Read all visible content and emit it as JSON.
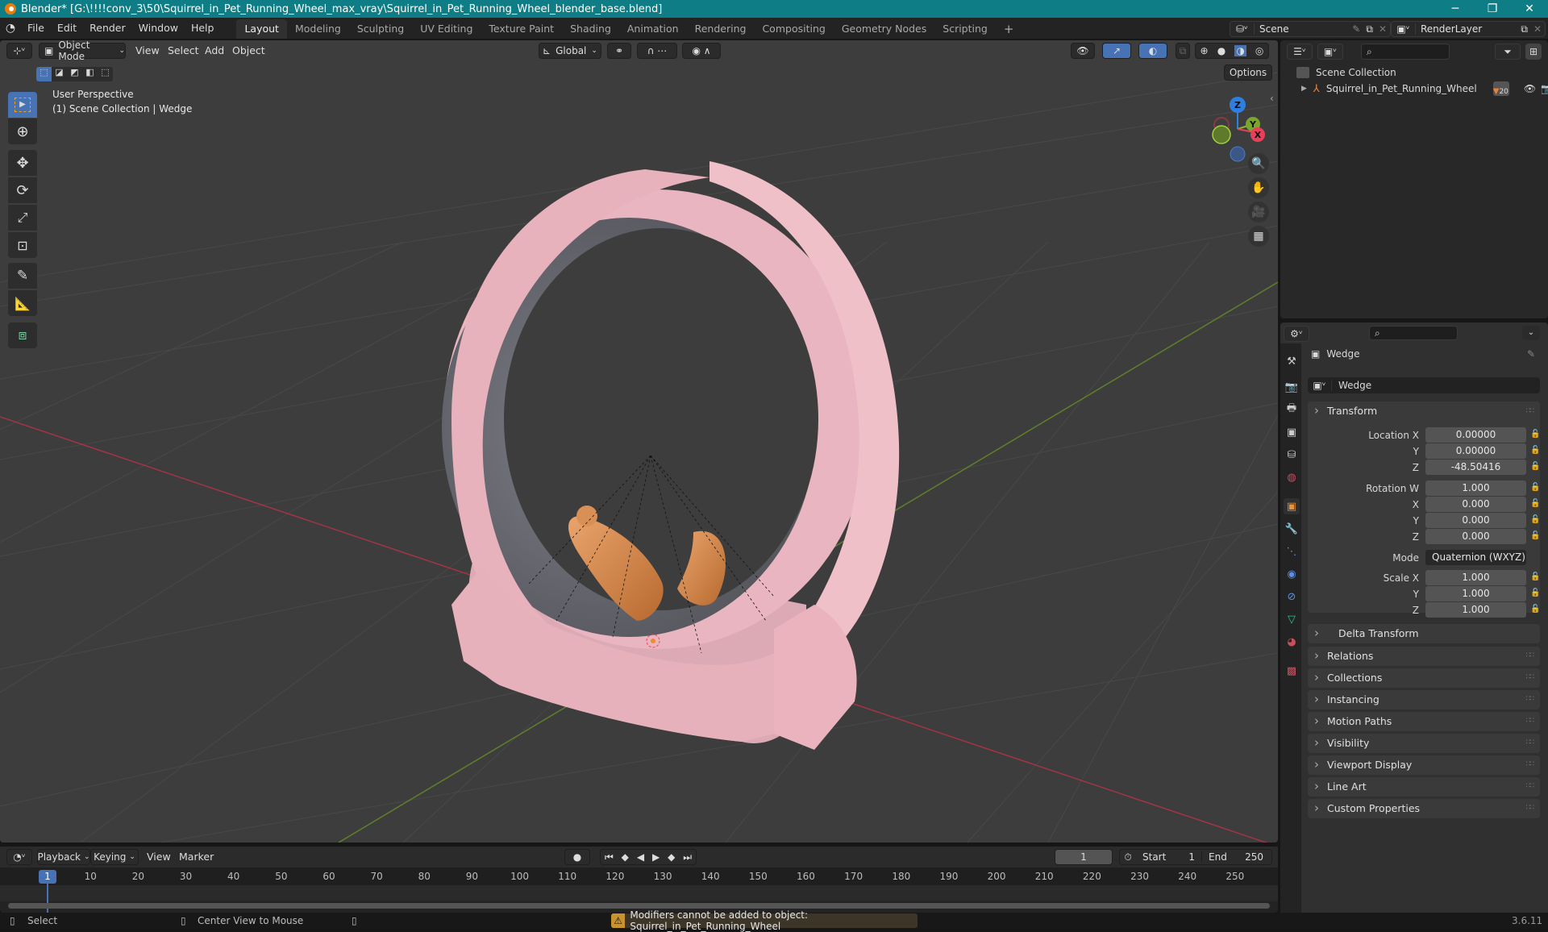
{
  "window": {
    "title": "Blender* [G:\\!!!!conv_3\\50\\Squirrel_in_Pet_Running_Wheel_max_vray\\Squirrel_in_Pet_Running_Wheel_blender_base.blend]",
    "controls": {
      "minimize": "─",
      "maximize": "❐",
      "close": "✕"
    }
  },
  "menubar": {
    "items": [
      "File",
      "Edit",
      "Render",
      "Window",
      "Help"
    ],
    "workspaces": [
      "Layout",
      "Modeling",
      "Sculpting",
      "UV Editing",
      "Texture Paint",
      "Shading",
      "Animation",
      "Rendering",
      "Compositing",
      "Geometry Nodes",
      "Scripting"
    ],
    "active_workspace": "Layout",
    "add_workspace": "+",
    "scene": "Scene",
    "view_layer": "RenderLayer"
  },
  "viewport": {
    "mode": "Object Mode",
    "menus": [
      "View",
      "Select",
      "Add",
      "Object"
    ],
    "transform_orientation": "Global",
    "options_label": "Options",
    "overlay_title": "User Perspective",
    "overlay_subtitle": "(1) Scene Collection | Wedge",
    "gizmo_axes": {
      "x": "X",
      "y": "Y",
      "z": "Z"
    },
    "colors": {
      "x_axis": "#e8405a",
      "y_axis": "#8ab33a",
      "z_axis": "#2f7fe0",
      "model": "#e9b5c0",
      "accent": "#4772b3"
    }
  },
  "outliner": {
    "root": "Scene Collection",
    "items": [
      {
        "name": "Squirrel_in_Pet_Running_Wheel",
        "child_count": "20"
      }
    ]
  },
  "properties": {
    "object_name": "Wedge",
    "data_name": "Wedge",
    "transform": {
      "title": "Transform",
      "location_label": "Location X",
      "location": {
        "x": "0.00000",
        "y": "0.00000",
        "z": "-48.50416"
      },
      "rotation_label": "Rotation W",
      "rotation": {
        "w": "1.000",
        "x": "0.000",
        "y": "0.000",
        "z": "0.000"
      },
      "mode_label": "Mode",
      "mode": "Quaternion (WXYZ)",
      "scale_label": "Scale X",
      "scale": {
        "x": "1.000",
        "y": "1.000",
        "z": "1.000"
      },
      "axis_labels": {
        "x": "X",
        "y": "Y",
        "z": "Z"
      },
      "delta": "Delta Transform"
    },
    "panels": [
      "Relations",
      "Collections",
      "Instancing",
      "Motion Paths",
      "Visibility",
      "Viewport Display",
      "Line Art",
      "Custom Properties"
    ]
  },
  "timeline": {
    "menus": [
      "Playback",
      "Keying",
      "View",
      "Marker"
    ],
    "current_frame": "1",
    "start_label": "Start",
    "start": "1",
    "end_label": "End",
    "end": "250",
    "ticks": [
      "10",
      "20",
      "30",
      "40",
      "50",
      "60",
      "70",
      "80",
      "90",
      "100",
      "110",
      "120",
      "130",
      "140",
      "150",
      "160",
      "170",
      "180",
      "190",
      "200",
      "210",
      "220",
      "230",
      "240",
      "250"
    ],
    "playhead": "1"
  },
  "statusbar": {
    "select": "Select",
    "center_view": "Center View to Mouse",
    "warning": "Modifiers cannot be added to object: Squirrel_in_Pet_Running_Wheel",
    "version": "3.6.11"
  }
}
